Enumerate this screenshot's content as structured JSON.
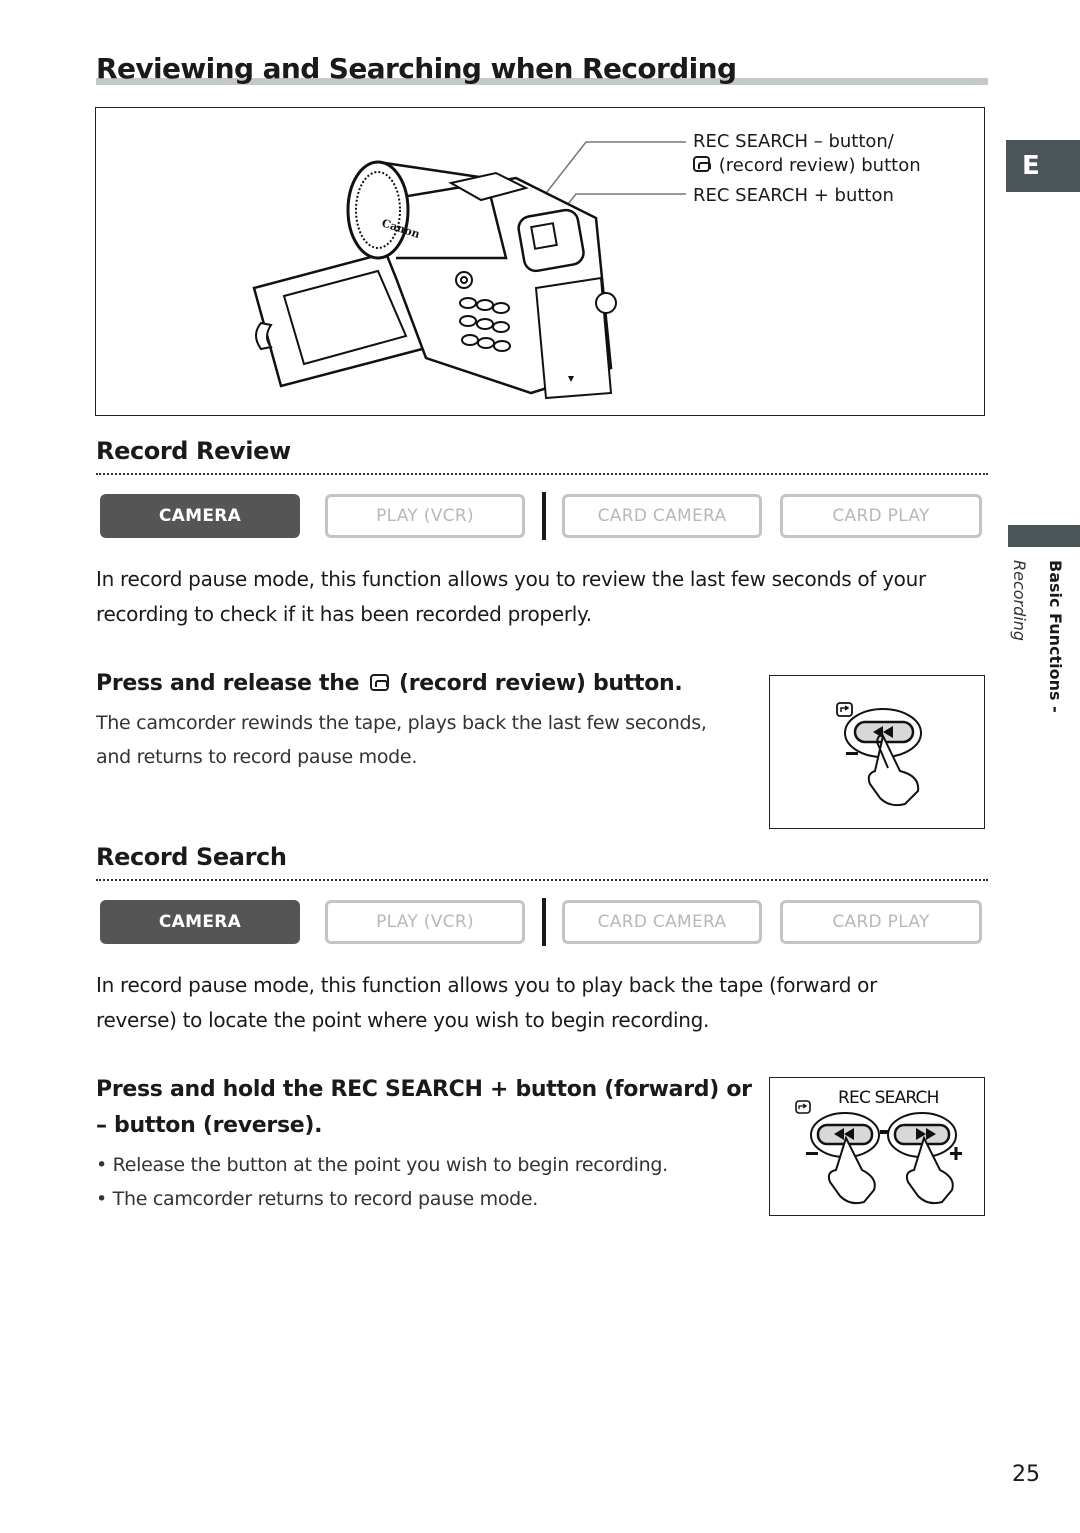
{
  "page": {
    "title": "Reviewing and Searching when Recording",
    "language_tab": "E",
    "side_tab": {
      "section": "Basic Functions -",
      "subsection": "Recording"
    },
    "page_number": "25"
  },
  "figure": {
    "callouts": [
      "REC SEARCH – button/",
      "(record review) button",
      "REC SEARCH + button"
    ],
    "icons": [
      "camcorder-illustration",
      "record-review-icon"
    ]
  },
  "record_review": {
    "heading": "Record Review",
    "modes": [
      {
        "label": "CAMERA",
        "active": true
      },
      {
        "label": "PLAY (VCR)",
        "active": false
      },
      {
        "label": "CARD CAMERA",
        "active": false
      },
      {
        "label": "CARD PLAY",
        "active": false
      }
    ],
    "description": "In record pause mode, this function allows you to review the last few seconds of your recording to check if it has been recorded properly.",
    "step": {
      "heading_pre": "Press and release the",
      "heading_post": "(record review) button.",
      "text": "The camcorder rewinds the tape, plays back the last few seconds, and returns to record pause mode."
    },
    "illustration": {
      "minus_label": "–"
    }
  },
  "record_search": {
    "heading": "Record Search",
    "modes": [
      {
        "label": "CAMERA",
        "active": true
      },
      {
        "label": "PLAY (VCR)",
        "active": false
      },
      {
        "label": "CARD CAMERA",
        "active": false
      },
      {
        "label": "CARD PLAY",
        "active": false
      }
    ],
    "description": "In record pause mode, this function allows you to play back the tape (forward or reverse) to locate the point where you wish to begin recording.",
    "step": {
      "heading": "Press and hold the REC SEARCH + button (forward) or – button (reverse).",
      "bullets": [
        "• Release the button at the point you wish to begin recording.",
        "• The camcorder returns to record pause mode."
      ]
    },
    "illustration": {
      "label": "REC SEARCH",
      "minus_label": "–",
      "plus_label": "+",
      "dash": "-"
    }
  },
  "colors": {
    "tab_bg": "#4a5459",
    "active_mode_bg": "#555555",
    "inactive_mode_border": "#c4c4c4",
    "title_bar": "#c3c9cb"
  }
}
